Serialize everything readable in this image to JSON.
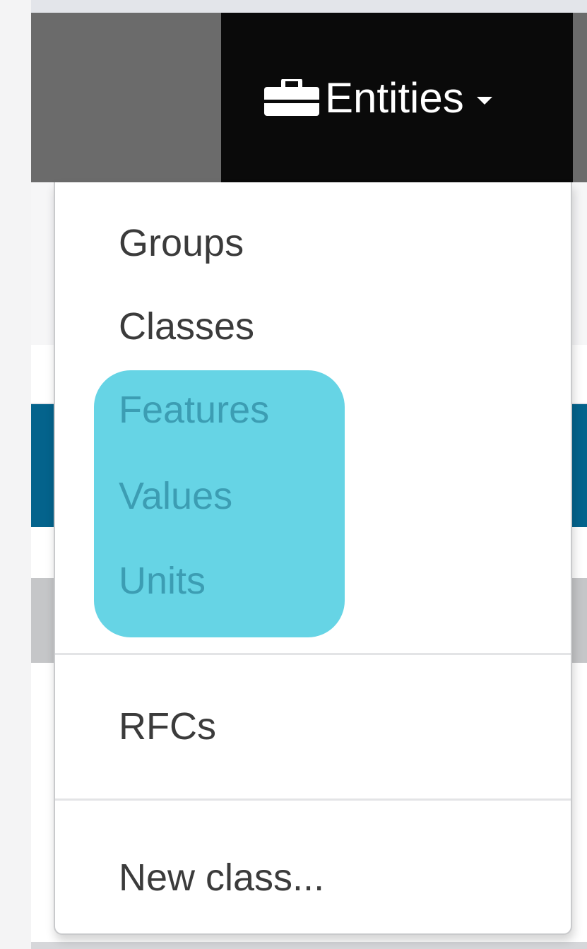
{
  "navbar": {
    "entities_label": "Entities",
    "icons": {
      "entities": "briefcase-icon",
      "dropdown": "caret-down-icon"
    }
  },
  "dropdown": {
    "groups": "Groups",
    "classes": "Classes",
    "features": "Features",
    "values": "Values",
    "units": "Units",
    "rfcs": "RFCs",
    "new_class": "New class..."
  },
  "colors": {
    "navbar": "#0a0a0a",
    "highlight": "#66d4e5",
    "accent_blue": "#04638c"
  }
}
